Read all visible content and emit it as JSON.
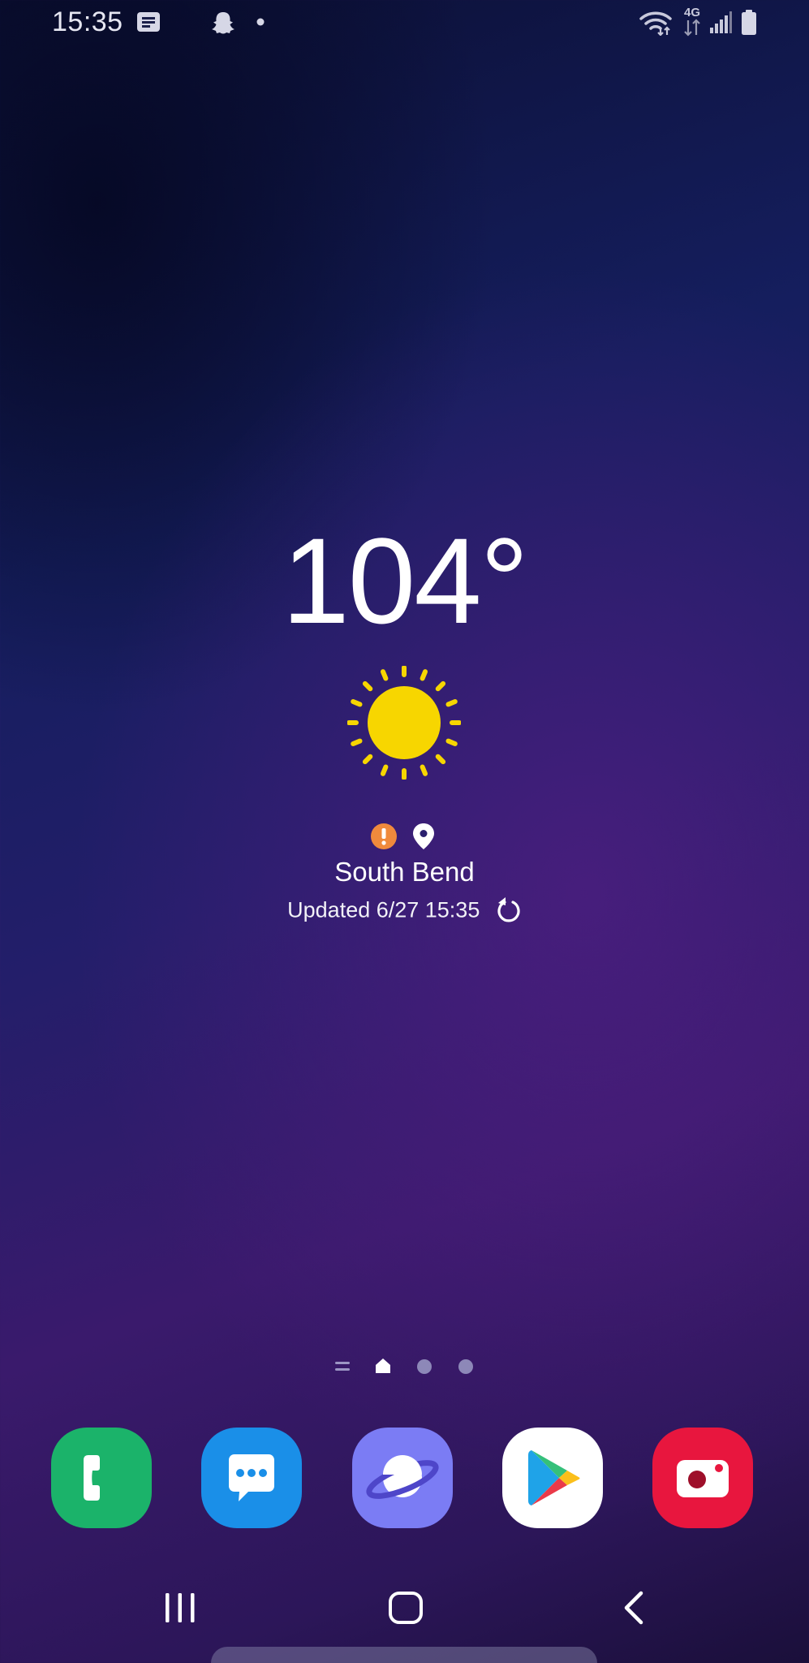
{
  "status_bar": {
    "time": "15:35",
    "network_label": "4G",
    "icons": [
      "message-notification-icon",
      "snapchat-icon",
      "dot-icon",
      "wifi-icon",
      "4g-lte-icon",
      "signal-icon",
      "battery-icon"
    ]
  },
  "weather": {
    "temperature": "104°",
    "condition_icon": "sun-icon",
    "location": "South Bend",
    "updated": "Updated 6/27 15:35",
    "colors": {
      "sun": "#f7d600",
      "alert": "#f08a3c"
    }
  },
  "page_indicator": {
    "pages": [
      "apps-list",
      "home",
      "page",
      "page"
    ],
    "current": "home"
  },
  "dock": {
    "apps": [
      {
        "name": "Phone",
        "icon": "phone-icon",
        "color": "#1bb36a"
      },
      {
        "name": "Messages",
        "icon": "messages-icon",
        "color": "#1a8fe8"
      },
      {
        "name": "Internet",
        "icon": "internet-icon",
        "color": "#7b7cf4"
      },
      {
        "name": "Play Store",
        "icon": "play-store-icon",
        "color": "#ffffff"
      },
      {
        "name": "Camera",
        "icon": "camera-icon",
        "color": "#e8163e"
      }
    ]
  },
  "nav_bar": {
    "buttons": [
      "recents",
      "home",
      "back"
    ]
  }
}
